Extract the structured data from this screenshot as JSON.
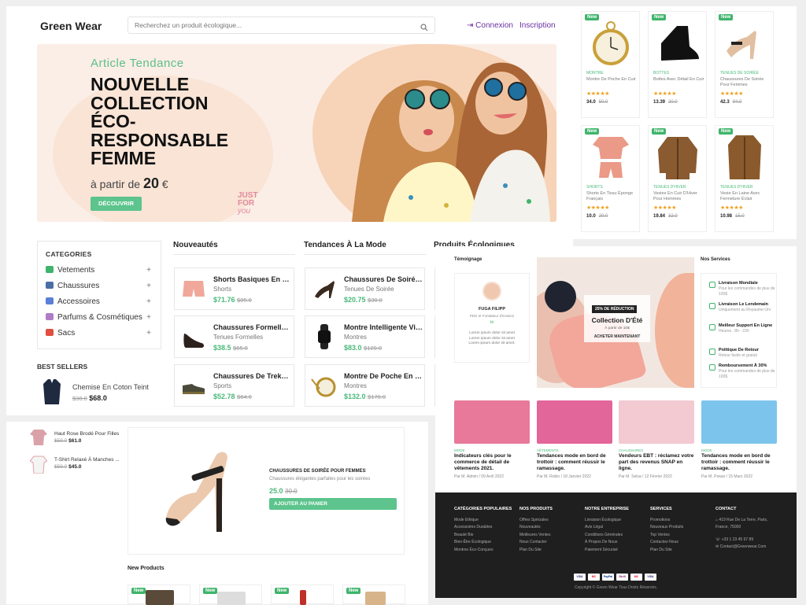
{
  "header": {
    "logo": "Green Wear",
    "search_placeholder": "Recherchez un produit écologique...",
    "login": "Connexion",
    "signup": "Inscription"
  },
  "hero": {
    "kicker": "Article Tendance",
    "title_lines": [
      "NOUVELLE",
      "COLLECTION",
      "ÉCO-",
      "RESPONSABLE",
      "FEMME"
    ],
    "price_prefix": "à partir de",
    "price_value": "20",
    "price_currency": "€",
    "button": "DÉCOUVRIR",
    "sticker_line1": "JUST",
    "sticker_line2": "FOR",
    "sticker_line3": "you"
  },
  "right_grid": [
    {
      "tag": "New",
      "category": "MONTRE",
      "name": "Montre De Poche En Cuir",
      "stars": "★★★★★",
      "price": "34.0",
      "old": "50.0",
      "icon": "pocket-watch"
    },
    {
      "tag": "New",
      "category": "BOTTES",
      "name": "Bottes Avec Détail En Cuir",
      "stars": "★★★★★",
      "price": "13.39",
      "old": "20.0",
      "icon": "leather-boot"
    },
    {
      "tag": "New",
      "category": "TENUES DE SOIRÉE",
      "name": "Chaussures De Soirée Pour Femmes",
      "stars": "★★★★★",
      "price": "42.3",
      "old": "94.0",
      "icon": "high-heel"
    },
    {
      "tag": "New",
      "category": "SHORTS",
      "name": "Shorts En Tissu Éponge Français",
      "stars": "★★★★★",
      "price": "10.0",
      "old": "20.0",
      "icon": "tshirt-shorts-set"
    },
    {
      "tag": "New",
      "category": "TENUES D'HIVER",
      "name": "Vestes En Cuir D'Hiver Pour Hommes",
      "stars": "★★★★★",
      "price": "19.84",
      "old": "32.0",
      "icon": "leather-jacket"
    },
    {
      "tag": "New",
      "category": "TENUES D'HIVER",
      "name": "Veste En Laine Avec Fermeture Éclair",
      "stars": "★★★★★",
      "price": "10.98",
      "old": "15.0",
      "icon": "wool-coat"
    }
  ],
  "categories": {
    "title": "CATEGORIES",
    "items": [
      {
        "label": "Vetements",
        "color": "#3fb46b"
      },
      {
        "label": "Chaussures",
        "color": "#4a6fa5"
      },
      {
        "label": "Accessoires",
        "color": "#5b7fd6"
      },
      {
        "label": "Parfums & Cosmétiques",
        "color": "#b07cc6"
      },
      {
        "label": "Sacs",
        "color": "#e04f3f"
      }
    ]
  },
  "best_sellers": {
    "title": "BEST SELLERS",
    "name": "Chemise En Coton Teint",
    "old": "$38.0",
    "price": "$68.0"
  },
  "nouveautes": {
    "title": "Nouveautés",
    "items": [
      {
        "name": "Shorts Basiques En Tis...",
        "cat": "Shorts",
        "price": "$71.76",
        "old": "$85.0",
        "icon": "shorts"
      },
      {
        "name": "Chaussures Formelles...",
        "cat": "Tenues Formelles",
        "price": "$38.5",
        "old": "$65.0",
        "icon": "formal-shoe"
      },
      {
        "name": "Chaussures De Trekki...",
        "cat": "Sports",
        "price": "$52.78",
        "old": "$64.0",
        "icon": "trekking-shoe"
      }
    ]
  },
  "tendances": {
    "title": "Tendances À La Mode",
    "items": [
      {
        "name": "Chaussures De Soirée ...",
        "cat": "Tenues De Soirée",
        "price": "$20.75",
        "old": "$30.0",
        "icon": "evening-shoe"
      },
      {
        "name": "Montre Intelligente Vit...",
        "cat": "Montres",
        "price": "$83.0",
        "old": "$120.0",
        "icon": "smart-watch"
      },
      {
        "name": "Montre De Poche En C...",
        "cat": "Montres",
        "price": "$132.0",
        "old": "$170.0",
        "icon": "pocket-watch"
      }
    ]
  },
  "eco_title": "Produits Écologiques",
  "lower_left": {
    "mini": [
      {
        "name": "Haut Rose Brodé Pour Filles",
        "old": "$59.0",
        "price": "$61.0"
      },
      {
        "name": "T-Shirt Relaxé À Manches ...",
        "old": "$59.0",
        "price": "$45.0"
      }
    ],
    "product": {
      "name": "CHAUSSURES DE SOIRÉE POUR FEMMES",
      "desc": "Chaussures élégantes parfaites pour les soirées",
      "price": "25.0",
      "old": "30.0",
      "button": "AJOUTER AU PANIER"
    },
    "new_products_title": "New Products",
    "new_tag": "New"
  },
  "testimonial": {
    "title": "Témoignage",
    "name": "FUGA FILIPP",
    "role": "PDG et Fondateur d'Invision",
    "quote_mark": "“",
    "text": "Lorem ipsum dolor sit amet Lorem ipsum dolor sit amet Lorem ipsum dolor sit amet."
  },
  "summer": {
    "badge": "25% DE RÉDUCTION",
    "title": "Collection D'Été",
    "sub": "À partir de 10$",
    "button": "ACHETER MAINTENANT"
  },
  "services": {
    "title": "Nos Services",
    "items": [
      {
        "title": "Livraison Mondiale",
        "desc": "Pour les commandes de plus de 100$"
      },
      {
        "title": "Livraison Le Lendemain",
        "desc": "Uniquement au Royaume-Uni"
      },
      {
        "title": "Meilleur Support En Ligne",
        "desc": "Heures : 8h - 22h"
      },
      {
        "title": "Politique De Retour",
        "desc": "Retour facile et gratuit"
      },
      {
        "title": "Remboursement À 30%",
        "desc": "Pour les commandes de plus de 100$"
      }
    ]
  },
  "blog": [
    {
      "cat": "MODE",
      "title": "Indicateurs clés pour le commerce de détail de vêtements 2021.",
      "meta": "Par M. Admin / 09 Avril 2022",
      "color": "#e8799a"
    },
    {
      "cat": "VÊTEMENTS",
      "title": "Tendances mode en bord de trottoir : comment réussir le ramassage.",
      "meta": "Par M. Robin / 18 Janvier 2022",
      "color": "#e2669a"
    },
    {
      "cat": "CHAUSSURES",
      "title": "Vendeurs EBT : réclamez votre part des revenus SNAP en ligne.",
      "meta": "Par M. Selsa / 12 Février 2022",
      "color": "#f3c9d2"
    },
    {
      "cat": "MODE",
      "title": "Tendances mode en bord de trottoir : comment réussir le ramassage.",
      "meta": "Par M. Powar / 15 Mars 2022",
      "color": "#7cc4ec"
    }
  ],
  "footer": {
    "cols": [
      {
        "title": "CATÉGORIES POPULAIRES",
        "links": [
          "Mode Ethique",
          "Accessoires Durables",
          "Beauté Bio",
          "Bien-Être Écologique",
          "Montres Éco-Conçues"
        ]
      },
      {
        "title": "NOS PRODUITS",
        "links": [
          "Offres Spéciales",
          "Nouveautés",
          "Meilleures Ventes",
          "Nous Contacter",
          "Plan Du Site"
        ]
      },
      {
        "title": "NOTRE ENTREPRISE",
        "links": [
          "Livraison Écologique",
          "Avis Légal",
          "Conditions Générales",
          "À Propos De Nous",
          "Paiement Sécurisé"
        ]
      },
      {
        "title": "SERVICES",
        "links": [
          "Promotions",
          "Nouveaux Produits",
          "Top Ventes",
          "Contactez-Nous",
          "Plan Du Site"
        ]
      }
    ],
    "contact_title": "CONTACT",
    "contact": [
      "419 Rue De La Terre, Paris, France, 75000",
      "+33 1 23 45 67 89",
      "Contact@Greenwear.Com"
    ],
    "payments": [
      "VISA",
      "MC",
      "PayPal",
      "Skrill",
      "MC",
      "VISA"
    ],
    "copyright": "Copyright © Green Wear Tous Droits Réservés."
  }
}
